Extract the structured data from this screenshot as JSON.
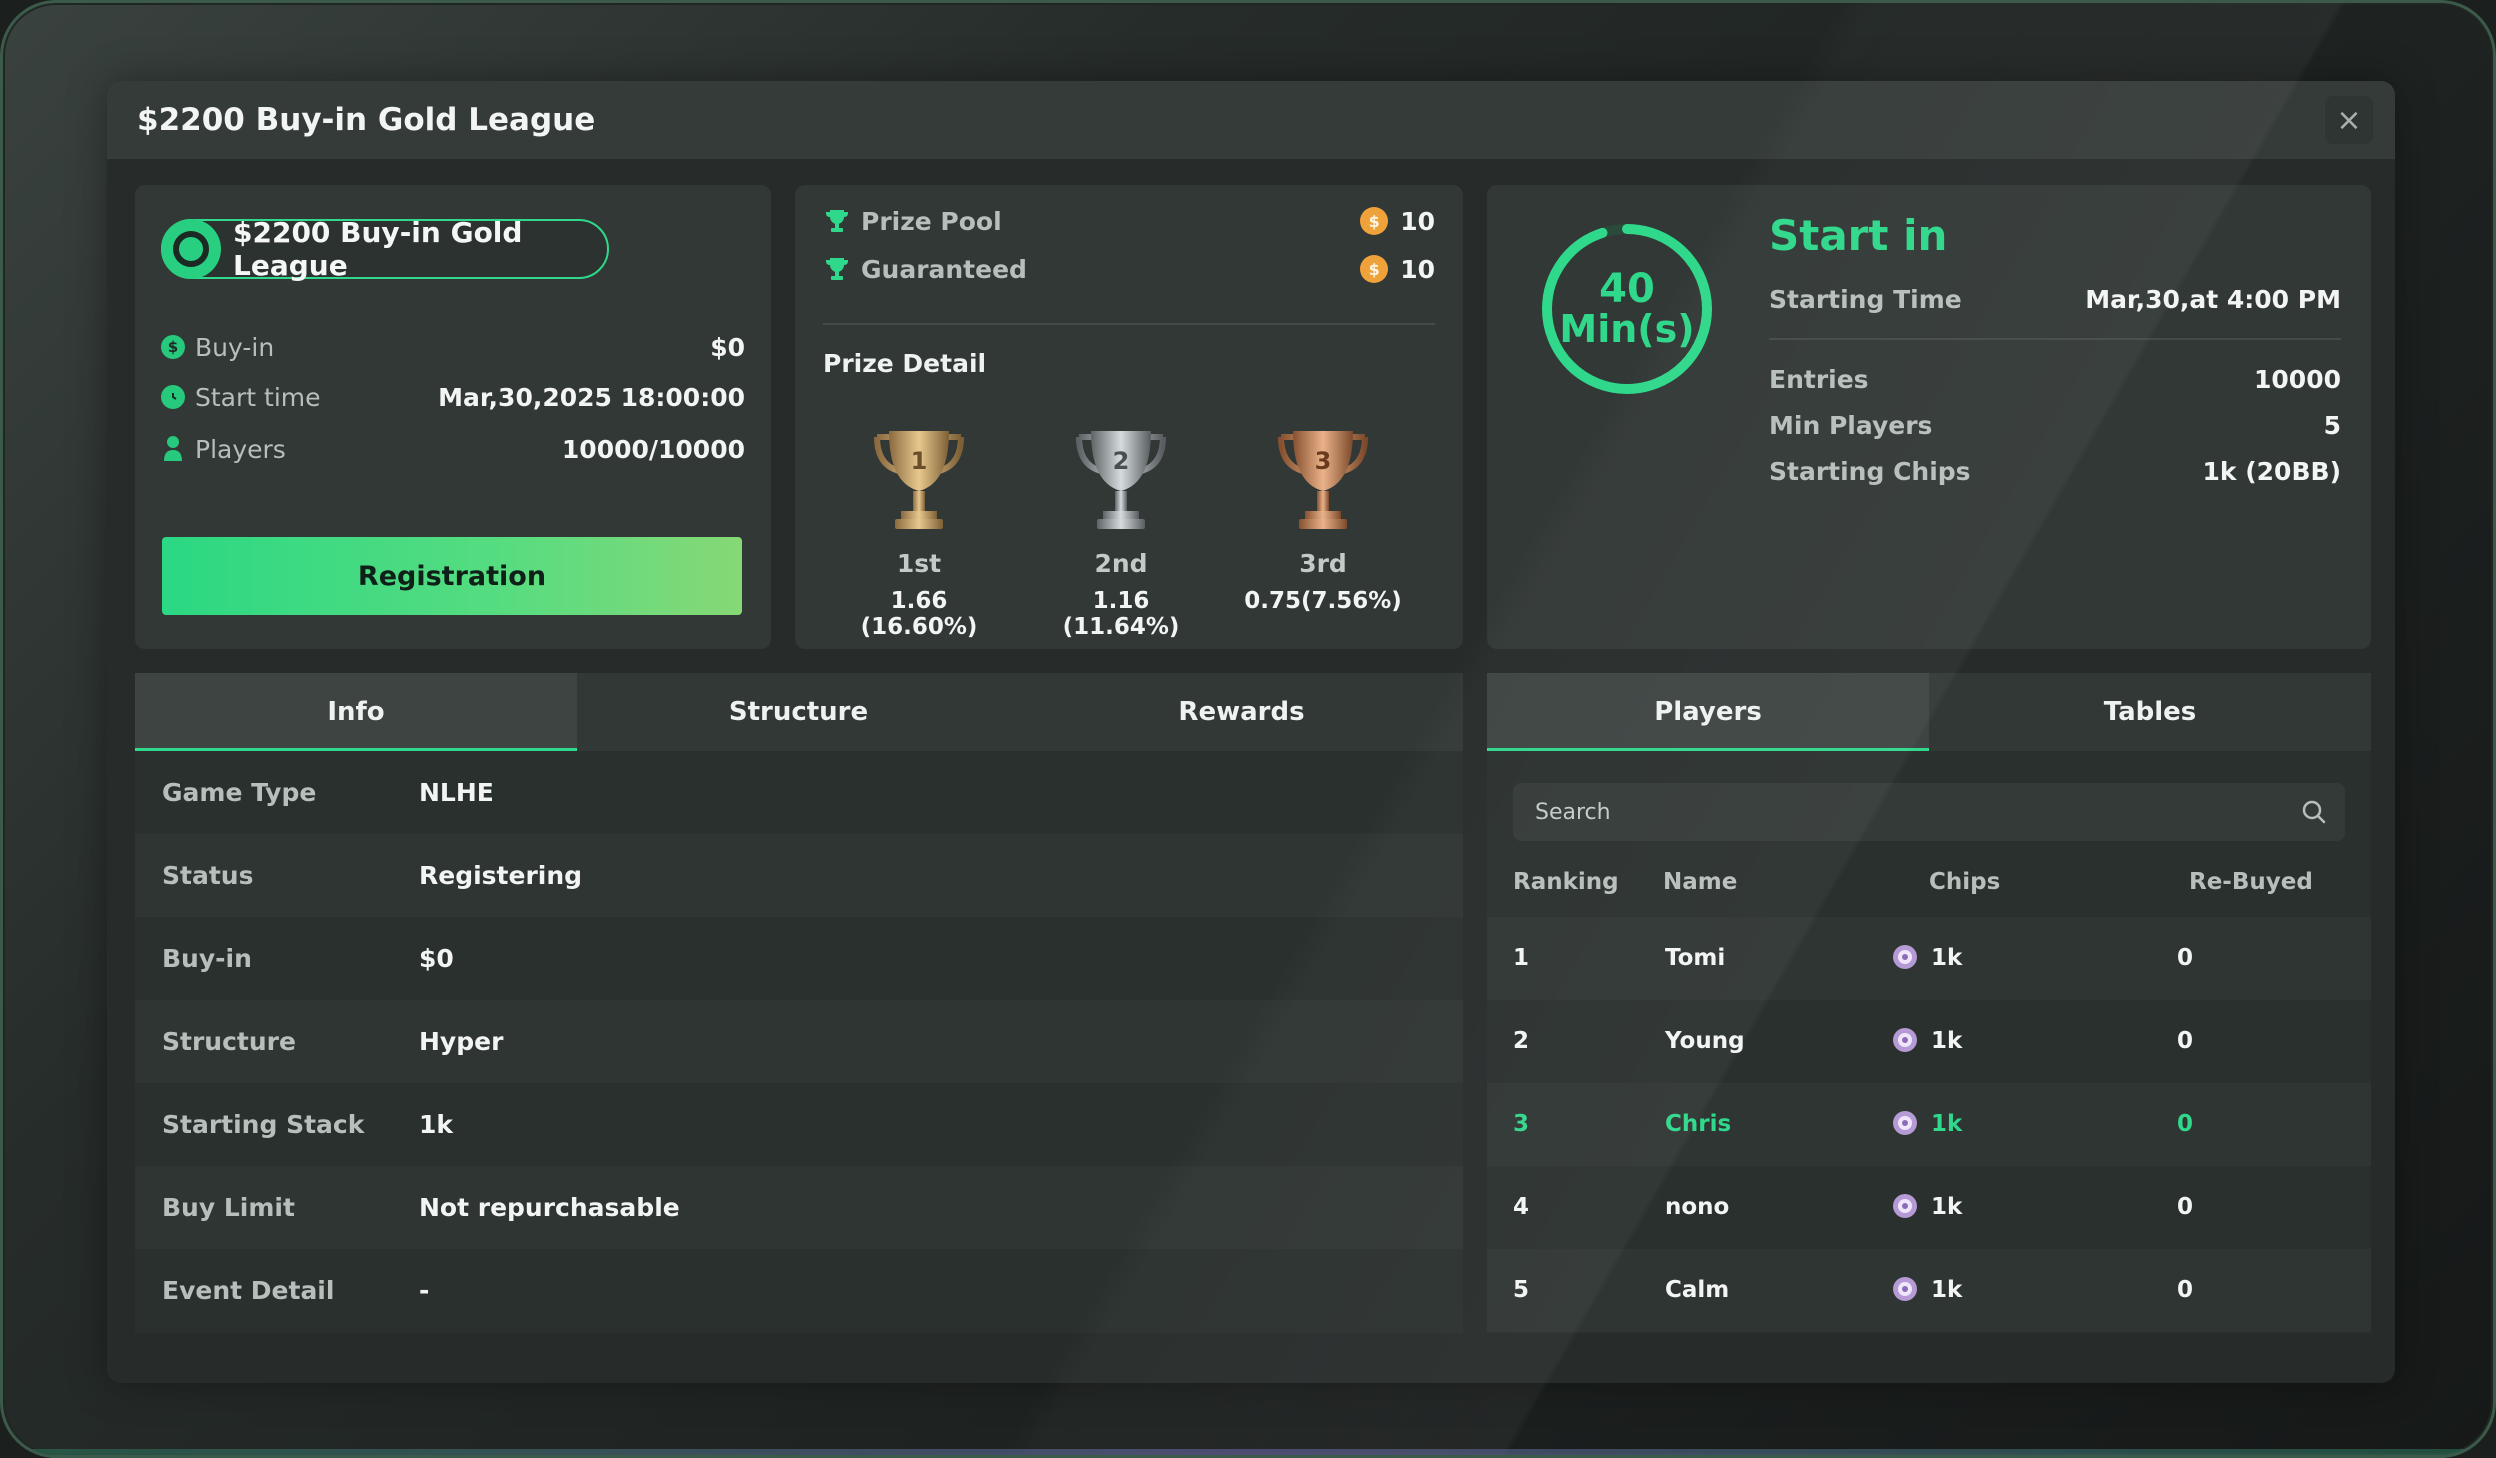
{
  "modal": {
    "title": "$2200 Buy-in Gold League",
    "close_icon": "×"
  },
  "summary": {
    "badge_title": "$2200 Buy-in Gold League",
    "rows": [
      {
        "icon": "dollar-icon",
        "label": "Buy-in",
        "value": "$0"
      },
      {
        "icon": "clock-icon",
        "label": "Start time",
        "value": "Mar,30,2025 18:00:00"
      },
      {
        "icon": "person-icon",
        "label": "Players",
        "value": "10000/10000"
      }
    ],
    "register_label": "Registration"
  },
  "prize": {
    "pool_label": "Prize Pool",
    "pool_value": "10",
    "guaranteed_label": "Guaranteed",
    "guaranteed_value": "10",
    "coin_symbol": "$",
    "detail_label": "Prize Detail",
    "places": [
      {
        "place": "1st",
        "amount": "1.66 (16.60%)",
        "color": "#c9a46a"
      },
      {
        "place": "2nd",
        "amount": "1.16 (11.64%)",
        "color": "#a7adb0"
      },
      {
        "place": "3rd",
        "amount": "0.75(7.56%)",
        "color": "#c98a5e"
      }
    ]
  },
  "countdown": {
    "number": "40",
    "unit": "Min(s)",
    "progress": 0.95,
    "title": "Start in",
    "starting_time_label": "Starting Time",
    "starting_time_value": "Mar,30,at 4:00 PM",
    "rows": [
      {
        "label": "Entries",
        "value": "10000"
      },
      {
        "label": "Min Players",
        "value": "5"
      },
      {
        "label": "Starting Chips",
        "value": "1k (20BB)"
      }
    ]
  },
  "info_tabs": {
    "tabs": [
      "Info",
      "Structure",
      "Rewards"
    ],
    "active": "Info",
    "rows": [
      {
        "label": "Game Type",
        "value": "NLHE"
      },
      {
        "label": "Status",
        "value": "Registering"
      },
      {
        "label": "Buy-in",
        "value": "$0"
      },
      {
        "label": "Structure",
        "value": "Hyper"
      },
      {
        "label": "Starting Stack",
        "value": "1k"
      },
      {
        "label": "Buy Limit",
        "value": "Not repurchasable"
      },
      {
        "label": "Event Detail",
        "value": "-"
      }
    ]
  },
  "players_tabs": {
    "tabs": [
      "Players",
      "Tables"
    ],
    "active": "Players",
    "search_placeholder": "Search",
    "columns": [
      "Ranking",
      "Name",
      "Chips",
      "Re-Buyed"
    ],
    "rows": [
      {
        "rank": "1",
        "name": "Tomi",
        "chips": "1k",
        "rebuyed": "0"
      },
      {
        "rank": "2",
        "name": "Young",
        "chips": "1k",
        "rebuyed": "0"
      },
      {
        "rank": "3",
        "name": "Chris",
        "chips": "1k",
        "rebuyed": "0",
        "highlight": true
      },
      {
        "rank": "4",
        "name": "nono",
        "chips": "1k",
        "rebuyed": "0"
      },
      {
        "rank": "5",
        "name": "Calm",
        "chips": "1k",
        "rebuyed": "0"
      }
    ]
  },
  "colors": {
    "accent": "#2fd88a",
    "coin": "#f0a23a",
    "chip": "#b59ad6"
  }
}
